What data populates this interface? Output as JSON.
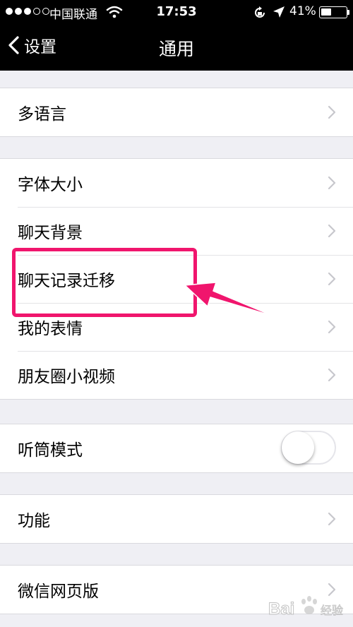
{
  "status_bar": {
    "carrier": "中国联通",
    "time": "17:53",
    "battery": "41%",
    "battery_level": 0.41,
    "signal_bars_filled": 3,
    "signal_bars_total": 5
  },
  "nav": {
    "back_label": "设置",
    "title": "通用"
  },
  "sections": {
    "language": {
      "items": [
        "多语言"
      ]
    },
    "chat": {
      "items": [
        "字体大小",
        "聊天背景",
        "聊天记录迁移",
        "我的表情",
        "朋友圈小视频"
      ]
    },
    "earpiece": {
      "label": "听筒模式",
      "toggle_on": false
    },
    "features": {
      "items": [
        "功能"
      ]
    },
    "web": {
      "items": [
        "微信网页版"
      ]
    }
  },
  "annotation": {
    "color": "#f0156d",
    "highlighted_item": "聊天记录迁移"
  },
  "watermark": "Baidu 经验",
  "colors": {
    "nav_background": "#000000",
    "page_background": "#efeff4",
    "chevron": "#c7c7cc"
  }
}
